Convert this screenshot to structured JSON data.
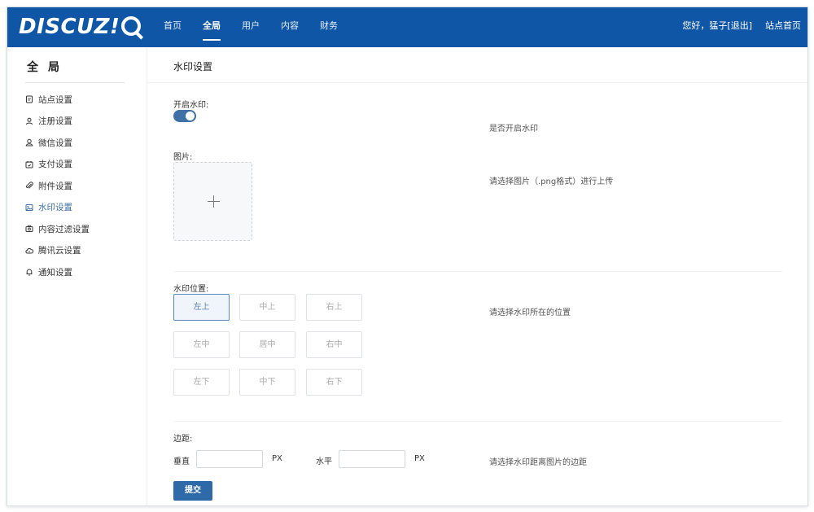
{
  "header": {
    "logo": "DISCUZ!",
    "nav": [
      "首页",
      "全局",
      "用户",
      "内容",
      "财务"
    ],
    "active_nav": "全局",
    "greeting": "您好，猛子",
    "logout": "[退出]",
    "site_home": "站点首页"
  },
  "sidebar": {
    "title": "全局",
    "items": [
      {
        "label": "站点设置",
        "icon": "document-icon"
      },
      {
        "label": "注册设置",
        "icon": "user-icon"
      },
      {
        "label": "微信设置",
        "icon": "user-circle-icon"
      },
      {
        "label": "支付设置",
        "icon": "wallet-icon"
      },
      {
        "label": "附件设置",
        "icon": "paperclip-icon"
      },
      {
        "label": "水印设置",
        "icon": "image-icon",
        "active": true
      },
      {
        "label": "内容过滤设置",
        "icon": "camera-icon"
      },
      {
        "label": "腾讯云设置",
        "icon": "cloud-icon"
      },
      {
        "label": "通知设置",
        "icon": "bell-icon"
      }
    ]
  },
  "main": {
    "title": "水印设置",
    "watermark_toggle": {
      "label": "开启水印:",
      "on": true,
      "hint": "是否开启水印"
    },
    "image": {
      "label": "图片:",
      "hint": "请选择图片（.png格式）进行上传"
    },
    "position": {
      "label": "水印位置:",
      "hint": "请选择水印所在的位置",
      "options": [
        "左上",
        "中上",
        "右上",
        "左中",
        "居中",
        "右中",
        "左下",
        "中下",
        "右下"
      ],
      "selected": "左上"
    },
    "margin": {
      "label": "边距:",
      "vertical_label": "垂直",
      "horizontal_label": "水平",
      "unit": "PX",
      "vertical_value": "",
      "horizontal_value": "",
      "hint": "请选择水印距离图片的边距"
    },
    "submit_label": "提交"
  },
  "colors": {
    "topbar": "#0f57a6",
    "accent": "#3f71a6",
    "active_side": "#3d6fa5"
  }
}
